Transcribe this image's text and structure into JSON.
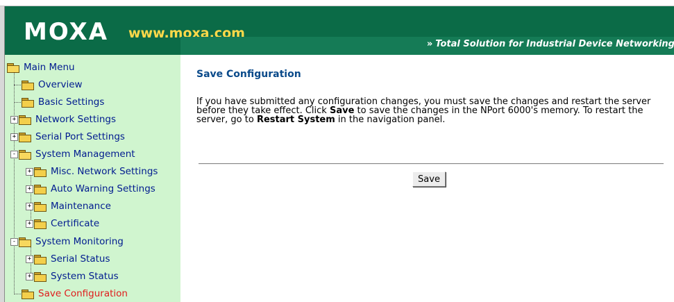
{
  "header": {
    "logo": "MOXA",
    "website": "www.moxa.com",
    "tagline_arrows": "»",
    "tagline": "Total Solution for Industrial Device Networking",
    "colors": {
      "background": "#0b6b47",
      "website": "#ffd94a",
      "tagline_bar": "#157b56"
    }
  },
  "sidebar": {
    "background": "#d0f5cf",
    "items": [
      {
        "label": "Main Menu",
        "icon": "folder-open-icon",
        "expand": ""
      },
      {
        "label": "Overview",
        "icon": "folder-icon",
        "expand": ""
      },
      {
        "label": "Basic Settings",
        "icon": "folder-icon",
        "expand": ""
      },
      {
        "label": "Network Settings",
        "icon": "folder-icon",
        "expand": "+"
      },
      {
        "label": "Serial Port Settings",
        "icon": "folder-icon",
        "expand": "+"
      },
      {
        "label": "System Management",
        "icon": "folder-open-icon",
        "expand": "-"
      },
      {
        "label": "Misc. Network Settings",
        "icon": "folder-icon",
        "expand": "+"
      },
      {
        "label": "Auto Warning Settings",
        "icon": "folder-icon",
        "expand": "+"
      },
      {
        "label": "Maintenance",
        "icon": "folder-icon",
        "expand": "+"
      },
      {
        "label": "Certificate",
        "icon": "folder-icon",
        "expand": "+"
      },
      {
        "label": "System Monitoring",
        "icon": "folder-open-icon",
        "expand": "-"
      },
      {
        "label": "Serial Status",
        "icon": "folder-icon",
        "expand": "+"
      },
      {
        "label": "System Status",
        "icon": "folder-icon",
        "expand": "+"
      },
      {
        "label": "Save Configuration",
        "icon": "folder-icon",
        "expand": "",
        "active": true
      }
    ]
  },
  "main": {
    "title": "Save Configuration",
    "desc_part1": "If you have submitted any configuration changes, you must save the changes and restart the server before they take effect. Click ",
    "desc_bold1": "Save",
    "desc_part2": " to save the changes in the NPort 6000's memory. To restart the server, go to ",
    "desc_bold2": "Restart System",
    "desc_part3": " in the navigation panel.",
    "save_label": "Save"
  }
}
